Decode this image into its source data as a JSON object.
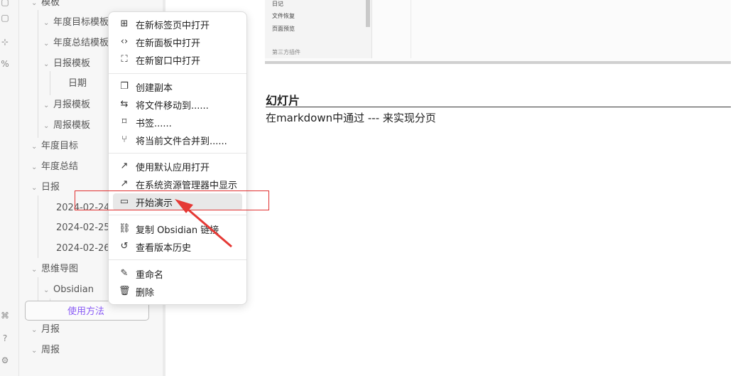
{
  "sidebar": {
    "items": [
      {
        "label": "模板",
        "chev": "⌄"
      },
      {
        "label": "年度目标模板",
        "chev": "⌄"
      },
      {
        "label": "年度总结模板",
        "chev": "⌄"
      },
      {
        "label": "日报模板",
        "chev": "⌄"
      },
      {
        "label": "日期",
        "chev": ""
      },
      {
        "label": "月报模板",
        "chev": "⌄"
      },
      {
        "label": "周报模板",
        "chev": "⌄"
      },
      {
        "label": "年度目标",
        "chev": "⌄"
      },
      {
        "label": "年度总结",
        "chev": "⌄"
      },
      {
        "label": "日报",
        "chev": "⌄"
      },
      {
        "label": "2024-02-24",
        "chev": ""
      },
      {
        "label": "2024-02-25",
        "chev": ""
      },
      {
        "label": "2024-02-26",
        "chev": ""
      },
      {
        "label": "思维导图",
        "chev": "⌄"
      },
      {
        "label": "Obsidian",
        "chev": "⌄"
      },
      {
        "label": "使用方法",
        "chev": ""
      },
      {
        "label": "月报",
        "chev": "⌄"
      },
      {
        "label": "周报",
        "chev": "⌄"
      }
    ]
  },
  "embed": {
    "lines": [
      "日记",
      "文件恢复",
      "页面预览",
      "第三方插件"
    ]
  },
  "doc": {
    "heading": "幻灯片",
    "paragraph": "在markdown中通过 --- 来实现分页"
  },
  "menu": {
    "items": [
      {
        "icon": "⊞",
        "label": "在新标签页中打开"
      },
      {
        "icon": "‹›",
        "label": "在新面板中打开"
      },
      {
        "icon": "⛶",
        "label": "在新窗口中打开"
      },
      {
        "icon": "❐",
        "label": "创建副本"
      },
      {
        "icon": "⇆",
        "label": "将文件移动到......"
      },
      {
        "icon": "⌑",
        "label": "书签......"
      },
      {
        "icon": "⑂",
        "label": "将当前文件合并到......"
      },
      {
        "icon": "↗",
        "label": "使用默认应用打开"
      },
      {
        "icon": "↗",
        "label": "在系统资源管理器中显示"
      },
      {
        "icon": "▭",
        "label": "开始演示"
      },
      {
        "icon": "⛓",
        "label": "复制 Obsidian 链接"
      },
      {
        "icon": "↺",
        "label": "查看版本历史"
      },
      {
        "icon": "✎",
        "label": "重命名"
      },
      {
        "icon": "🗑",
        "label": "删除"
      }
    ]
  },
  "ribbon": {
    "icons": [
      "▢",
      "⊹",
      "%",
      "?",
      "⚙",
      "⌘"
    ]
  }
}
